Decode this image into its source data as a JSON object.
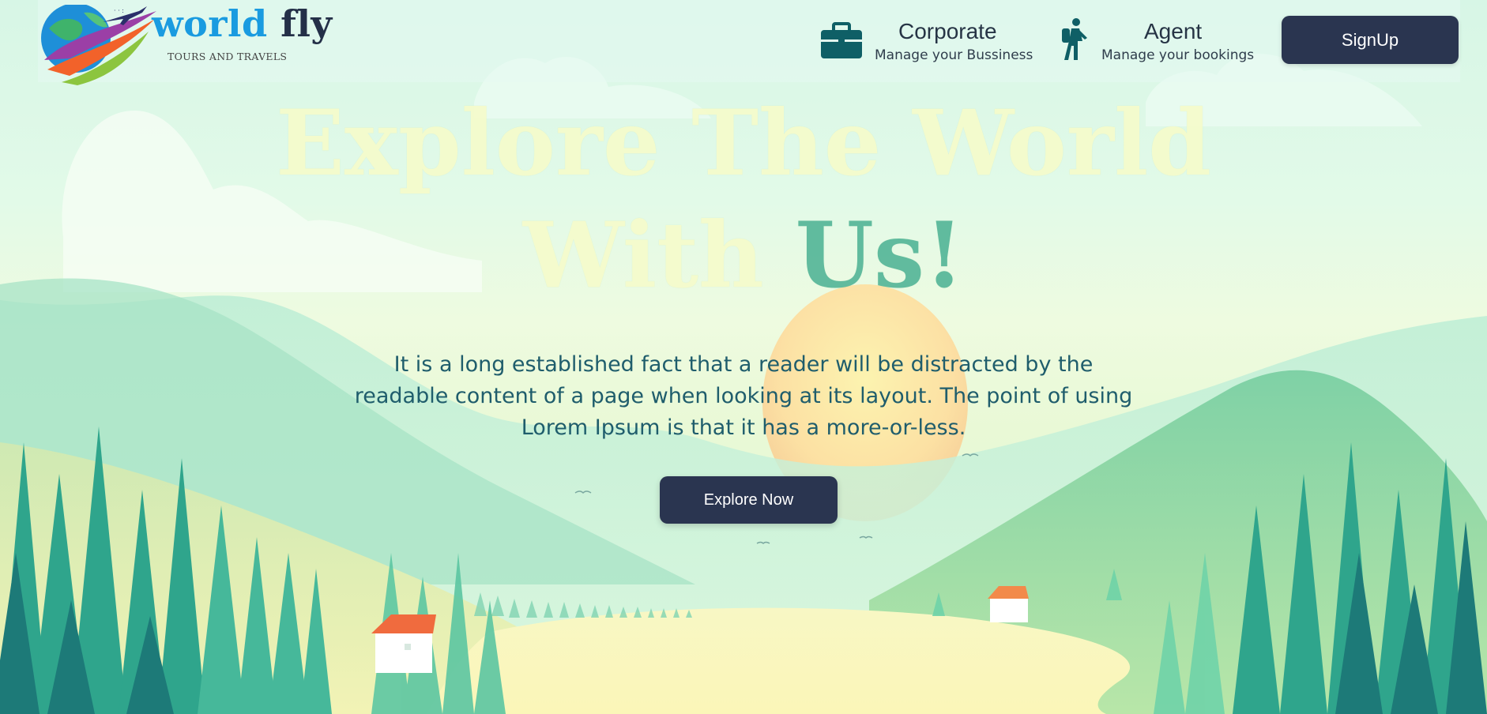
{
  "brand": {
    "name_part1": "world",
    "name_part2": "fly",
    "tagline": "TOURS AND TRAVELS"
  },
  "nav": {
    "corporate": {
      "title": "Corporate",
      "subtitle": "Manage your Bussiness",
      "icon": "briefcase-icon"
    },
    "agent": {
      "title": "Agent",
      "subtitle": "Manage your bookings",
      "icon": "hiker-icon"
    },
    "signup_label": "SignUp"
  },
  "hero": {
    "title_line1": "Explore The World",
    "title_line2_a": "With ",
    "title_line2_b": "Us!",
    "description": "It is a long established fact that a reader will be distracted by the readable content of a page when looking at its layout. The point of using Lorem Ipsum is that it has a more-or-less.",
    "cta_label": "Explore Now"
  },
  "colors": {
    "button": "#2a3550",
    "brand_blue": "#1a9be0",
    "brand_dark": "#243048",
    "text_teal": "#1f5d6c"
  }
}
